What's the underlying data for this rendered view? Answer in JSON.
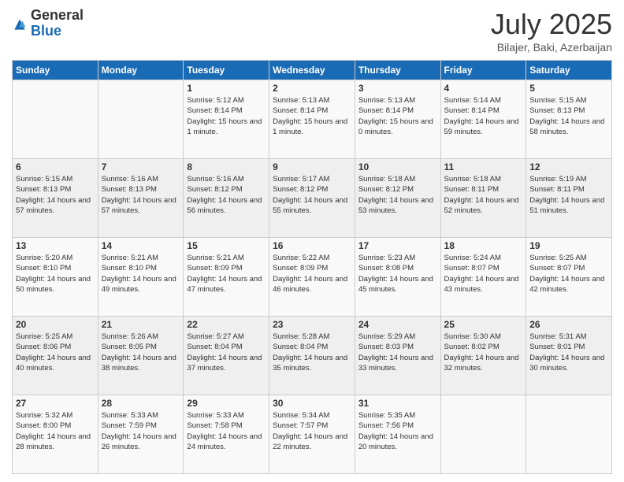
{
  "header": {
    "logo_general": "General",
    "logo_blue": "Blue",
    "month_title": "July 2025",
    "location": "Bilajer, Baki, Azerbaijan"
  },
  "days_of_week": [
    "Sunday",
    "Monday",
    "Tuesday",
    "Wednesday",
    "Thursday",
    "Friday",
    "Saturday"
  ],
  "weeks": [
    [
      {
        "day": "",
        "info": ""
      },
      {
        "day": "",
        "info": ""
      },
      {
        "day": "1",
        "info": "Sunrise: 5:12 AM\nSunset: 8:14 PM\nDaylight: 15 hours and 1 minute."
      },
      {
        "day": "2",
        "info": "Sunrise: 5:13 AM\nSunset: 8:14 PM\nDaylight: 15 hours and 1 minute."
      },
      {
        "day": "3",
        "info": "Sunrise: 5:13 AM\nSunset: 8:14 PM\nDaylight: 15 hours and 0 minutes."
      },
      {
        "day": "4",
        "info": "Sunrise: 5:14 AM\nSunset: 8:14 PM\nDaylight: 14 hours and 59 minutes."
      },
      {
        "day": "5",
        "info": "Sunrise: 5:15 AM\nSunset: 8:13 PM\nDaylight: 14 hours and 58 minutes."
      }
    ],
    [
      {
        "day": "6",
        "info": "Sunrise: 5:15 AM\nSunset: 8:13 PM\nDaylight: 14 hours and 57 minutes."
      },
      {
        "day": "7",
        "info": "Sunrise: 5:16 AM\nSunset: 8:13 PM\nDaylight: 14 hours and 57 minutes."
      },
      {
        "day": "8",
        "info": "Sunrise: 5:16 AM\nSunset: 8:12 PM\nDaylight: 14 hours and 56 minutes."
      },
      {
        "day": "9",
        "info": "Sunrise: 5:17 AM\nSunset: 8:12 PM\nDaylight: 14 hours and 55 minutes."
      },
      {
        "day": "10",
        "info": "Sunrise: 5:18 AM\nSunset: 8:12 PM\nDaylight: 14 hours and 53 minutes."
      },
      {
        "day": "11",
        "info": "Sunrise: 5:18 AM\nSunset: 8:11 PM\nDaylight: 14 hours and 52 minutes."
      },
      {
        "day": "12",
        "info": "Sunrise: 5:19 AM\nSunset: 8:11 PM\nDaylight: 14 hours and 51 minutes."
      }
    ],
    [
      {
        "day": "13",
        "info": "Sunrise: 5:20 AM\nSunset: 8:10 PM\nDaylight: 14 hours and 50 minutes."
      },
      {
        "day": "14",
        "info": "Sunrise: 5:21 AM\nSunset: 8:10 PM\nDaylight: 14 hours and 49 minutes."
      },
      {
        "day": "15",
        "info": "Sunrise: 5:21 AM\nSunset: 8:09 PM\nDaylight: 14 hours and 47 minutes."
      },
      {
        "day": "16",
        "info": "Sunrise: 5:22 AM\nSunset: 8:09 PM\nDaylight: 14 hours and 46 minutes."
      },
      {
        "day": "17",
        "info": "Sunrise: 5:23 AM\nSunset: 8:08 PM\nDaylight: 14 hours and 45 minutes."
      },
      {
        "day": "18",
        "info": "Sunrise: 5:24 AM\nSunset: 8:07 PM\nDaylight: 14 hours and 43 minutes."
      },
      {
        "day": "19",
        "info": "Sunrise: 5:25 AM\nSunset: 8:07 PM\nDaylight: 14 hours and 42 minutes."
      }
    ],
    [
      {
        "day": "20",
        "info": "Sunrise: 5:25 AM\nSunset: 8:06 PM\nDaylight: 14 hours and 40 minutes."
      },
      {
        "day": "21",
        "info": "Sunrise: 5:26 AM\nSunset: 8:05 PM\nDaylight: 14 hours and 38 minutes."
      },
      {
        "day": "22",
        "info": "Sunrise: 5:27 AM\nSunset: 8:04 PM\nDaylight: 14 hours and 37 minutes."
      },
      {
        "day": "23",
        "info": "Sunrise: 5:28 AM\nSunset: 8:04 PM\nDaylight: 14 hours and 35 minutes."
      },
      {
        "day": "24",
        "info": "Sunrise: 5:29 AM\nSunset: 8:03 PM\nDaylight: 14 hours and 33 minutes."
      },
      {
        "day": "25",
        "info": "Sunrise: 5:30 AM\nSunset: 8:02 PM\nDaylight: 14 hours and 32 minutes."
      },
      {
        "day": "26",
        "info": "Sunrise: 5:31 AM\nSunset: 8:01 PM\nDaylight: 14 hours and 30 minutes."
      }
    ],
    [
      {
        "day": "27",
        "info": "Sunrise: 5:32 AM\nSunset: 8:00 PM\nDaylight: 14 hours and 28 minutes."
      },
      {
        "day": "28",
        "info": "Sunrise: 5:33 AM\nSunset: 7:59 PM\nDaylight: 14 hours and 26 minutes."
      },
      {
        "day": "29",
        "info": "Sunrise: 5:33 AM\nSunset: 7:58 PM\nDaylight: 14 hours and 24 minutes."
      },
      {
        "day": "30",
        "info": "Sunrise: 5:34 AM\nSunset: 7:57 PM\nDaylight: 14 hours and 22 minutes."
      },
      {
        "day": "31",
        "info": "Sunrise: 5:35 AM\nSunset: 7:56 PM\nDaylight: 14 hours and 20 minutes."
      },
      {
        "day": "",
        "info": ""
      },
      {
        "day": "",
        "info": ""
      }
    ]
  ]
}
